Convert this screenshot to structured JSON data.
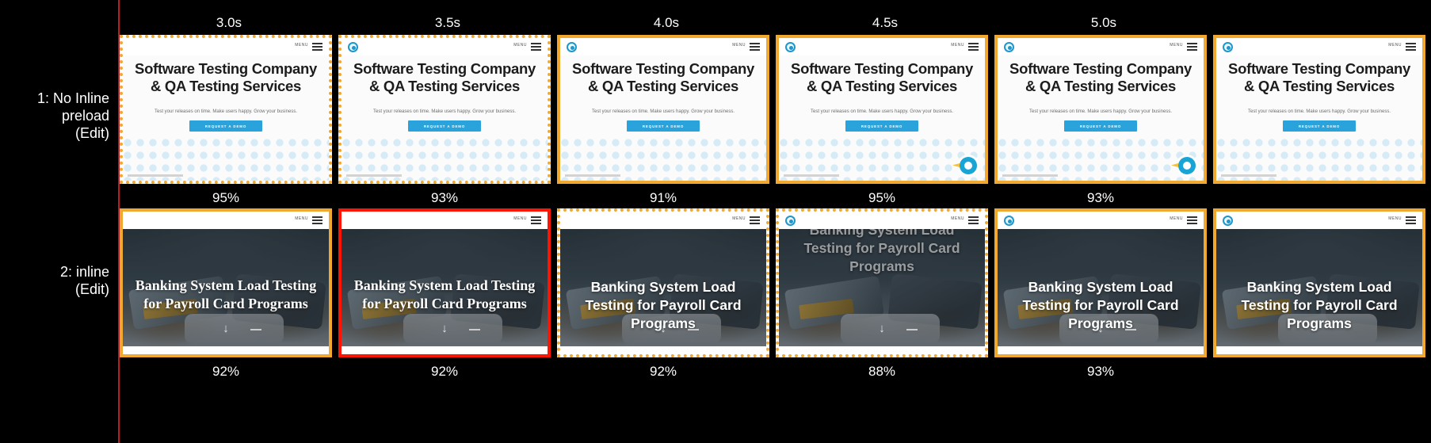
{
  "colors": {
    "background": "#000000",
    "border_orange": "#f0a830",
    "border_red": "#fa1505",
    "divider_red": "#b42020",
    "text": "#ffffff"
  },
  "rows": [
    {
      "label": "1: No Inline\npreload\n(Edit)",
      "page_type": "software-testing",
      "frames": [
        {
          "time": "3.0s",
          "percent": "95%",
          "border": "dotted-orange",
          "logo": false,
          "chat": false
        },
        {
          "time": "3.5s",
          "percent": "93%",
          "border": "dotted-orange",
          "logo": true,
          "chat": false
        },
        {
          "time": "4.0s",
          "percent": "91%",
          "border": "solid-orange",
          "logo": true,
          "chat": false
        },
        {
          "time": "4.5s",
          "percent": "95%",
          "border": "solid-orange",
          "logo": true,
          "chat": true
        },
        {
          "time": "5.0s",
          "percent": "93%",
          "border": "solid-orange",
          "logo": true,
          "chat": true
        },
        {
          "time": "",
          "percent": "",
          "border": "solid-orange",
          "logo": true,
          "chat": false
        }
      ]
    },
    {
      "label": "2: inline\n(Edit)",
      "page_type": "banking-load-testing",
      "frames": [
        {
          "time": "",
          "percent": "92%",
          "border": "solid-orange",
          "title_style": "serif",
          "logo": false,
          "arrow": true
        },
        {
          "time": "",
          "percent": "92%",
          "border": "solid-red",
          "title_style": "serif",
          "logo": false,
          "arrow": true
        },
        {
          "time": "",
          "percent": "92%",
          "border": "dotted-orange",
          "title_style": "sans",
          "logo": false,
          "arrow": true
        },
        {
          "time": "",
          "percent": "88%",
          "border": "dotted-orange",
          "title_style": "sans-high",
          "logo": true,
          "arrow": true
        },
        {
          "time": "",
          "percent": "93%",
          "border": "solid-orange",
          "title_style": "sans",
          "logo": true,
          "arrow": true
        },
        {
          "time": "",
          "percent": "",
          "border": "solid-orange",
          "title_style": "sans",
          "logo": true,
          "arrow": false
        }
      ]
    }
  ],
  "pages": {
    "software_testing": {
      "heading": "Software Testing Company & QA Testing Services",
      "subheading": "Test your releases on time. Make users happy. Grow your business.",
      "cta_label": "REQUEST A DEMO",
      "menu_label": "MENU"
    },
    "banking": {
      "heading": "Banking System Load Testing for Payroll Card Programs",
      "menu_label": "MENU"
    }
  }
}
